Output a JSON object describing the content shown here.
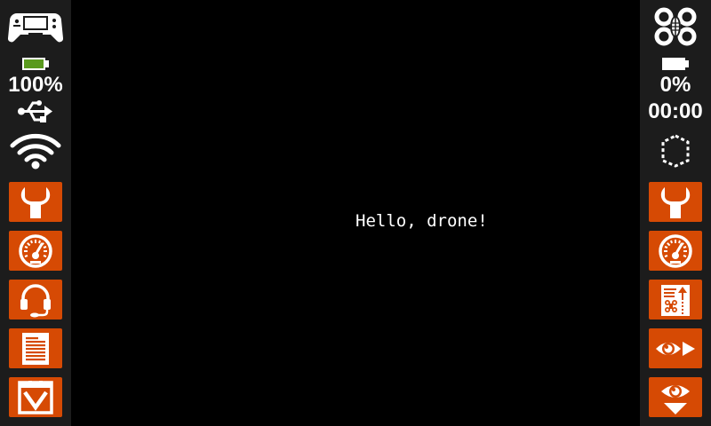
{
  "left_sidebar": {
    "battery_percent": "100%",
    "battery_level": 1.0,
    "battery_color": "#5a9a1e",
    "icons": [
      "gamepad-icon",
      "battery-icon",
      "usb-icon",
      "wifi-icon"
    ],
    "buttons": [
      {
        "name": "settings-wrench-button",
        "icon": "wrench-icon"
      },
      {
        "name": "dashboard-gauge-button",
        "icon": "gauge-icon"
      },
      {
        "name": "headset-button",
        "icon": "headset-icon"
      },
      {
        "name": "log-document-button",
        "icon": "document-icon"
      },
      {
        "name": "download-checkbox-button",
        "icon": "checkbox-down-icon"
      }
    ]
  },
  "right_sidebar": {
    "battery_percent": "0%",
    "battery_level": 0.0,
    "flight_time": "00:00",
    "icons": [
      "drone-icon",
      "battery-icon",
      "geofence-icon"
    ],
    "buttons": [
      {
        "name": "drone-settings-wrench-button",
        "icon": "wrench-icon"
      },
      {
        "name": "drone-dashboard-gauge-button",
        "icon": "gauge-icon"
      },
      {
        "name": "drone-log-button",
        "icon": "drone-log-icon"
      },
      {
        "name": "vision-forward-button",
        "icon": "eye-arrow-icon"
      },
      {
        "name": "vision-down-button",
        "icon": "eye-down-icon"
      }
    ]
  },
  "main": {
    "message": "Hello, drone!"
  },
  "colors": {
    "accent": "#d64a04",
    "sidebar_bg": "#1c1c1c",
    "background": "#000000",
    "foreground": "#ffffff"
  }
}
